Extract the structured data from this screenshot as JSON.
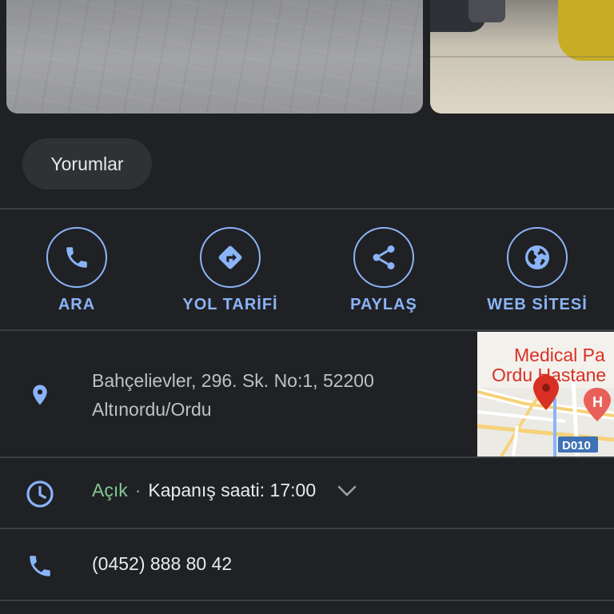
{
  "chips": {
    "reviews": "Yorumlar"
  },
  "actions": [
    {
      "label": "ARA",
      "icon": "phone-icon"
    },
    {
      "label": "YOL TARİFİ",
      "icon": "directions-icon"
    },
    {
      "label": "PAYLAŞ",
      "icon": "share-icon"
    },
    {
      "label": "WEB SİTESİ",
      "icon": "globe-icon"
    }
  ],
  "address": {
    "line1": "Bahçelievler, 296. Sk. No:1, 52200",
    "line2": "Altınordu/Ordu",
    "icon": "location-pin-icon"
  },
  "hours": {
    "status": "Açık",
    "separator": "·",
    "closing": "Kapanış saati: 17:00",
    "icon": "clock-icon"
  },
  "phone": {
    "number": "(0452) 888 80 42",
    "icon": "phone-icon"
  },
  "map": {
    "label_line1": "Medical Pa",
    "label_line2": "Ordu Hastane",
    "road_badge": "D010",
    "hospital_marker": "H"
  },
  "colors": {
    "background": "#202124",
    "accent": "#8ab4f8",
    "open": "#81c995",
    "divider": "#3c4043",
    "map_label": "#d93025"
  }
}
